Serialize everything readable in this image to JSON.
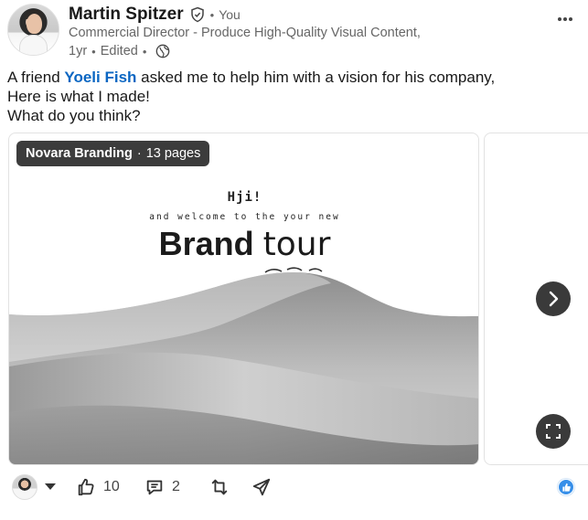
{
  "author": {
    "name": "Martin Spitzer",
    "relation": "You",
    "headline": "Commercial Director - Produce High-Quality Visual Content,",
    "time": "1yr",
    "edited": "Edited"
  },
  "post": {
    "line1_prefix": "A friend",
    "mention": "Yoeli Fish",
    "line1_suffix": "asked me to help him with a vision for his company,",
    "line2": "Here is what I made!",
    "line3": "What do you think?"
  },
  "document": {
    "title": "Novara Branding",
    "pages": "13 pages",
    "slide": {
      "greeting": "Hji!",
      "subtitle": "and welcome to the your new",
      "title_bold": "Brand",
      "title_light": "tour"
    }
  },
  "actions": {
    "likes": "10",
    "comments": "2"
  },
  "icons": {
    "verified": "verified-shield-icon",
    "globe": "globe-icon",
    "more": "more-options-icon",
    "next": "chevron-right-icon",
    "fullscreen": "fullscreen-icon",
    "like": "thumbs-up-icon",
    "comment": "comment-icon",
    "repost": "repost-icon",
    "send": "send-icon"
  },
  "colors": {
    "link": "#0a66c2",
    "badge_bg": "#3c3c3c",
    "reaction": "#378fe9"
  }
}
